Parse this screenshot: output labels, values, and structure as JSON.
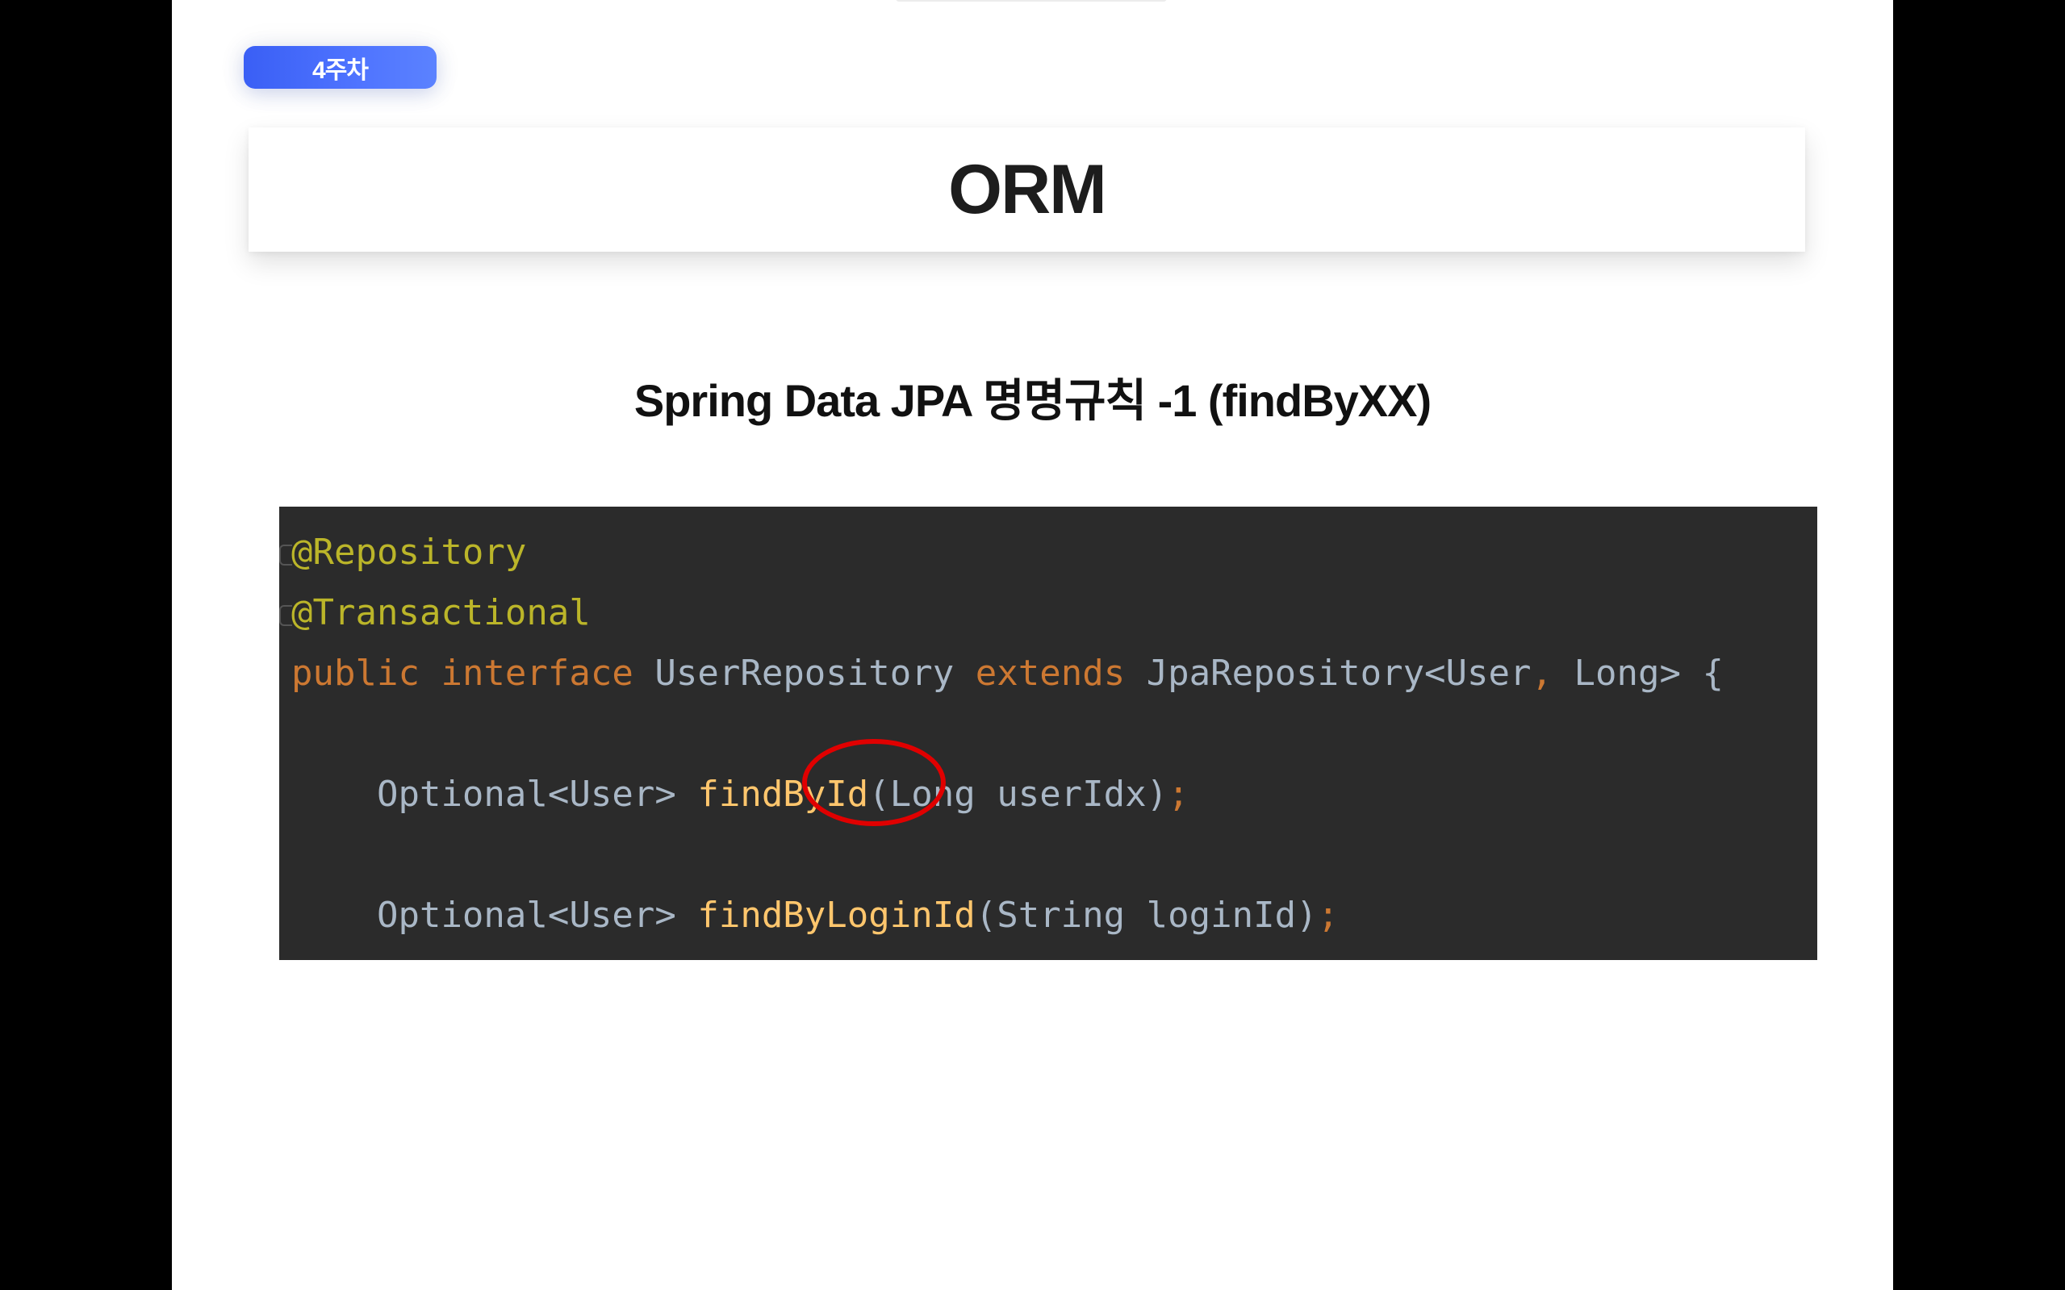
{
  "slide": {
    "week_badge": "4주차",
    "title": "ORM",
    "subtitle": "Spring Data JPA 명명규칙 -1 (findByXX)"
  },
  "code": {
    "line1": {
      "annotation": "@Repository"
    },
    "line2": {
      "annotation": "@Transactional"
    },
    "line3": {
      "kw_public": "public",
      "kw_interface": "interface",
      "name": "UserRepository",
      "kw_extends": "extends",
      "parent_type": "JpaRepository<User",
      "comma": ",",
      "generic_rest": "Long> {"
    },
    "line4": {
      "return_type": "Optional<User>",
      "method": "findById",
      "params": "(Long userIdx)",
      "semi": ";"
    },
    "line5": {
      "return_type": "Optional<User>",
      "method": "findByLoginId",
      "params": "(String loginId)",
      "semi": ";"
    }
  },
  "colors": {
    "badge": "#4f74ff",
    "code_background": "#2b2b2b",
    "annotation": "#bbb529",
    "keyword": "#cc7832",
    "method": "#ffc66d",
    "highlight_ring": "#e00000"
  }
}
